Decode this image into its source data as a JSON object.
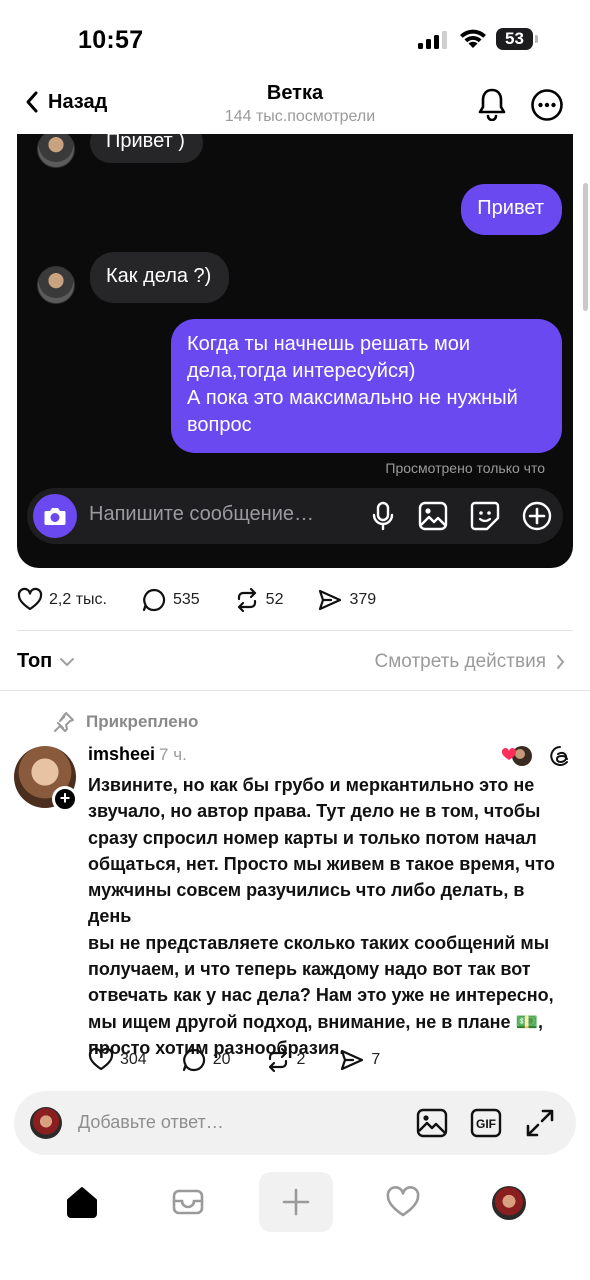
{
  "status_bar": {
    "time": "10:57",
    "battery": "53"
  },
  "header": {
    "back_label": "Назад",
    "title": "Ветка",
    "subtitle": "144 тыс.посмотрели"
  },
  "chat": {
    "messages": [
      {
        "side": "in",
        "text": "Привет )"
      },
      {
        "side": "out",
        "text": "Привет"
      },
      {
        "side": "in",
        "text": "Как дела ?)"
      },
      {
        "side": "out",
        "lines": [
          "Когда ты начнешь решать мои",
          "дела,тогда интересуйся)",
          "А пока это максимально не нужный",
          "вопрос"
        ]
      }
    ],
    "seen_text": "Просмотрено только что",
    "composer_placeholder": "Напишите сообщение…"
  },
  "post_stats": {
    "likes": "2,2 тыс.",
    "comments": "535",
    "reposts": "52",
    "shares": "379"
  },
  "sort": {
    "label": "Топ",
    "activity_link": "Смотреть действия"
  },
  "pinned_comment": {
    "pinned_label": "Прикреплено",
    "username": "imsheei",
    "time": "7 ч.",
    "text_lines": [
      "Извините, но как бы грубо и меркантильно это не",
      "звучало, но автор права. Тут дело не в том, чтобы",
      "сразу спросил номер карты и только потом начал",
      "общаться, нет. Просто мы живем в такое время, что",
      "мужчины совсем разучились что либо делать, в день",
      "вы не представляете сколько таких сообщений мы",
      "получаем, и что теперь каждому надо вот так вот",
      "отвечать как у нас дела? Нам это уже не интересно,",
      "мы ищем другой подход, внимание, не  в плане 💵,",
      "просто хотим разнообразия."
    ],
    "stats": {
      "likes": "304",
      "comments": "20",
      "reposts": "2",
      "shares": "7"
    }
  },
  "reply_bar": {
    "placeholder": "Добавьте ответ…",
    "gif_label": "GIF"
  },
  "colors": {
    "accent": "#6a49f1",
    "card_bg": "#0b0b0b",
    "bubble_in": "#262628"
  }
}
